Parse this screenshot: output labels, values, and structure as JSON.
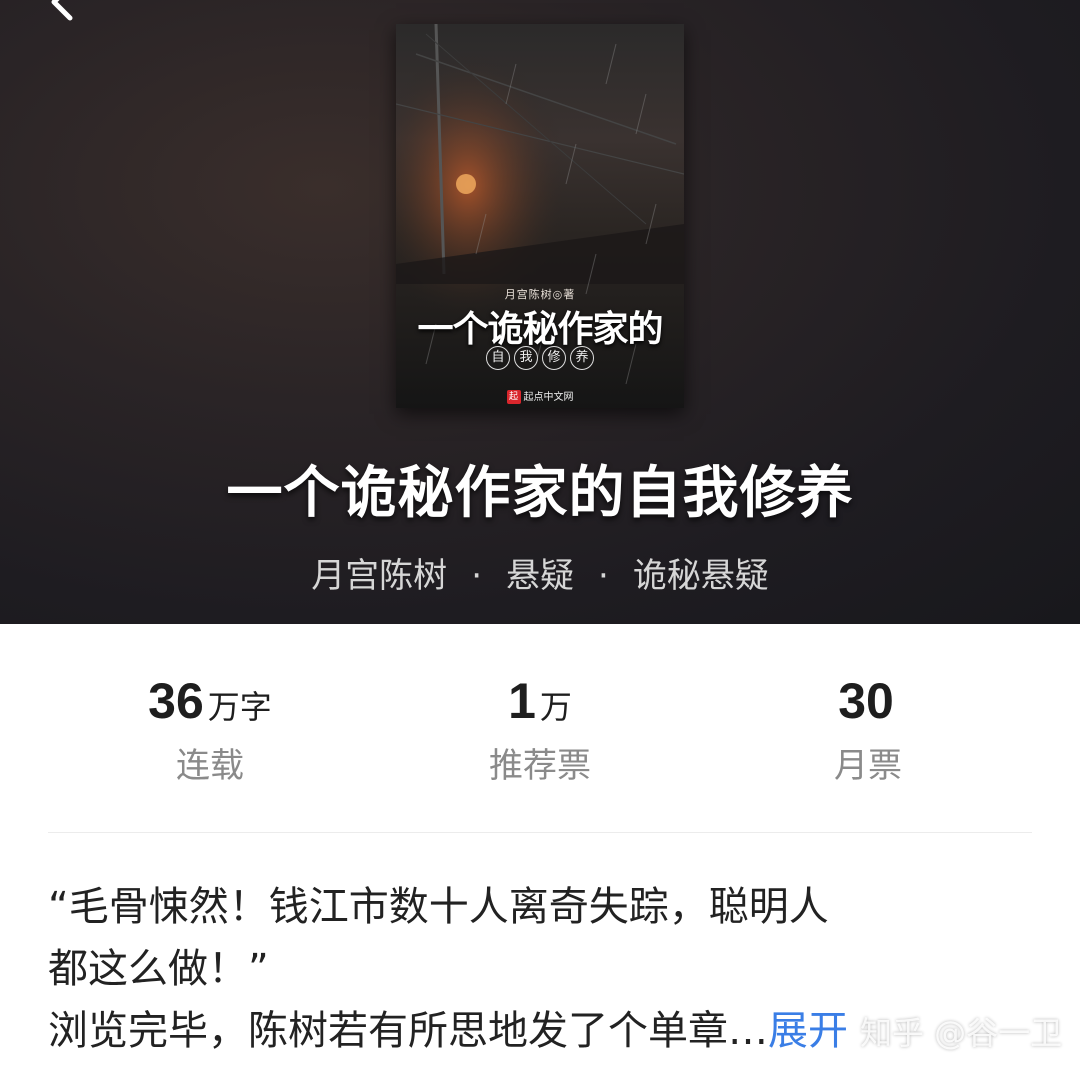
{
  "cover": {
    "author_line": "月宫陈树◎著",
    "title": "一个诡秘作家的",
    "subtitle_chars": [
      "自",
      "我",
      "修",
      "养"
    ],
    "publisher": "起点中文网",
    "publisher_logo": "起"
  },
  "book": {
    "title": "一个诡秘作家的自我修养",
    "author": "月宫陈树",
    "category": "悬疑",
    "subcategory": "诡秘悬疑",
    "separator": "·"
  },
  "stats": [
    {
      "value": "36",
      "unit": "万字",
      "label": "连载"
    },
    {
      "value": "1",
      "unit": "万",
      "label": "推荐票"
    },
    {
      "value": "30",
      "unit": "",
      "label": "月票"
    }
  ],
  "synopsis": {
    "line1": "“毛骨悚然！钱江市数十人离奇失踪，聪明人",
    "line2": "都这么做！”",
    "line3": "浏览完毕，陈树若有所思地发了个单章…",
    "expand_label": "展开"
  },
  "watermark": "知乎 @谷一卫",
  "colors": {
    "accent": "#3a7ee6",
    "hero_bg": "#1e1c21",
    "stat_label": "#8a8a8a"
  }
}
